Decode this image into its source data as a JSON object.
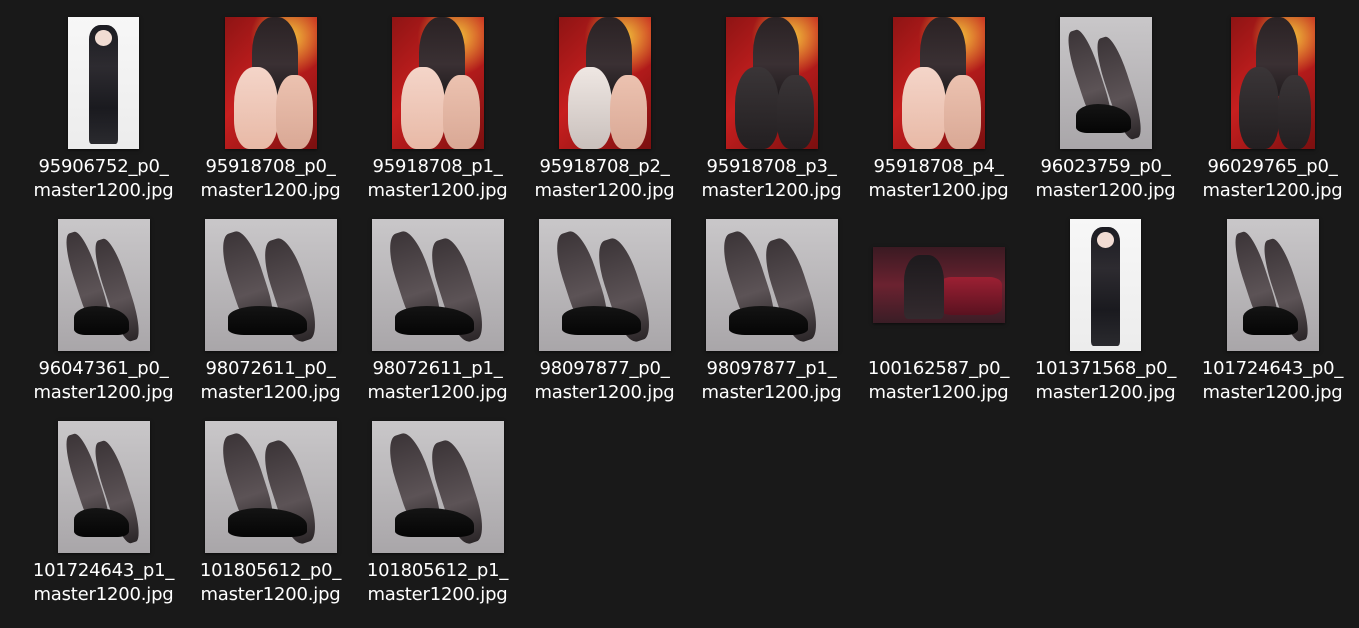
{
  "files": [
    {
      "line1": "95906752_p0_",
      "line2": "master1200.jpg",
      "w": 71,
      "h": 132,
      "art": "white"
    },
    {
      "line1": "95918708_p0_",
      "line2": "master1200.jpg",
      "w": 92,
      "h": 132,
      "art": "red"
    },
    {
      "line1": "95918708_p1_",
      "line2": "master1200.jpg",
      "w": 92,
      "h": 132,
      "art": "red"
    },
    {
      "line1": "95918708_p2_",
      "line2": "master1200.jpg",
      "w": 92,
      "h": 132,
      "art": "red-sheer"
    },
    {
      "line1": "95918708_p3_",
      "line2": "master1200.jpg",
      "w": 92,
      "h": 132,
      "art": "red-dark"
    },
    {
      "line1": "95918708_p4_",
      "line2": "master1200.jpg",
      "w": 92,
      "h": 132,
      "art": "red"
    },
    {
      "line1": "96023759_p0_",
      "line2": "master1200.jpg",
      "w": 92,
      "h": 132,
      "art": "grey"
    },
    {
      "line1": "96029765_p0_",
      "line2": "master1200.jpg",
      "w": 84,
      "h": 132,
      "art": "red-dark"
    },
    {
      "line1": "96047361_p0_",
      "line2": "master1200.jpg",
      "w": 92,
      "h": 132,
      "art": "grey"
    },
    {
      "line1": "98072611_p0_",
      "line2": "master1200.jpg",
      "w": 132,
      "h": 132,
      "art": "grey"
    },
    {
      "line1": "98072611_p1_",
      "line2": "master1200.jpg",
      "w": 132,
      "h": 132,
      "art": "grey"
    },
    {
      "line1": "98097877_p0_",
      "line2": "master1200.jpg",
      "w": 132,
      "h": 132,
      "art": "grey"
    },
    {
      "line1": "98097877_p1_",
      "line2": "master1200.jpg",
      "w": 132,
      "h": 132,
      "art": "grey"
    },
    {
      "line1": "100162587_p0_",
      "line2": "master1200.jpg",
      "w": 132,
      "h": 76,
      "art": "wide"
    },
    {
      "line1": "101371568_p0_",
      "line2": "master1200.jpg",
      "w": 71,
      "h": 132,
      "art": "white"
    },
    {
      "line1": "101724643_p0_",
      "line2": "master1200.jpg",
      "w": 92,
      "h": 132,
      "art": "grey"
    },
    {
      "line1": "101724643_p1_",
      "line2": "master1200.jpg",
      "w": 92,
      "h": 132,
      "art": "grey"
    },
    {
      "line1": "101805612_p0_",
      "line2": "master1200.jpg",
      "w": 132,
      "h": 132,
      "art": "grey"
    },
    {
      "line1": "101805612_p1_",
      "line2": "master1200.jpg",
      "w": 132,
      "h": 132,
      "art": "grey"
    }
  ]
}
